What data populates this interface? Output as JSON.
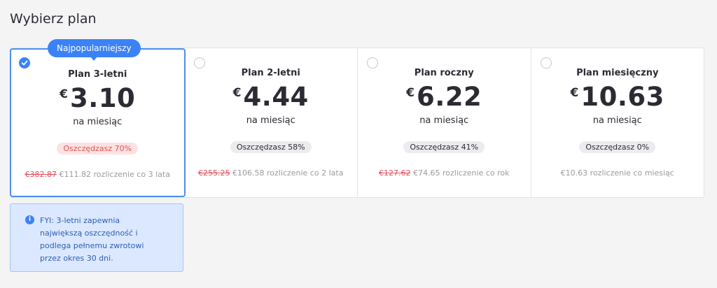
{
  "page": {
    "title": "Wybierz plan"
  },
  "popular_badge": "Najpopularniejszy",
  "plans": [
    {
      "name": "Plan 3-letni",
      "currency": "€",
      "price": "3.10",
      "per": "na miesiąc",
      "savings": "Oszczędzasz 70%",
      "old_price": "€382.87",
      "billing": "€111.82 rozliczenie co 3 lata",
      "selected": true
    },
    {
      "name": "Plan 2-letni",
      "currency": "€",
      "price": "4.44",
      "per": "na miesiąc",
      "savings": "Oszczędzasz 58%",
      "old_price": "€255.25",
      "billing": "€106.58 rozliczenie co 2 lata",
      "selected": false
    },
    {
      "name": "Plan roczny",
      "currency": "€",
      "price": "6.22",
      "per": "na miesiąc",
      "savings": "Oszczędzasz 41%",
      "old_price": "€127.62",
      "billing": "€74.65 rozliczenie co rok",
      "selected": false
    },
    {
      "name": "Plan miesięczny",
      "currency": "€",
      "price": "10.63",
      "per": "na miesiąc",
      "savings": "Oszczędzasz 0%",
      "old_price": "",
      "billing": "€10.63 rozliczenie co miesiąc",
      "selected": false
    }
  ],
  "info": {
    "icon": "info-icon",
    "text": "FYI: 3-letni zapewnia największą oszczędność i podlega pełnemu zwrotowi przez okres 30 dni."
  },
  "colors": {
    "accent": "#3b82f6",
    "discount_red": "#e0525a",
    "info_bg": "#dbe8ff"
  }
}
